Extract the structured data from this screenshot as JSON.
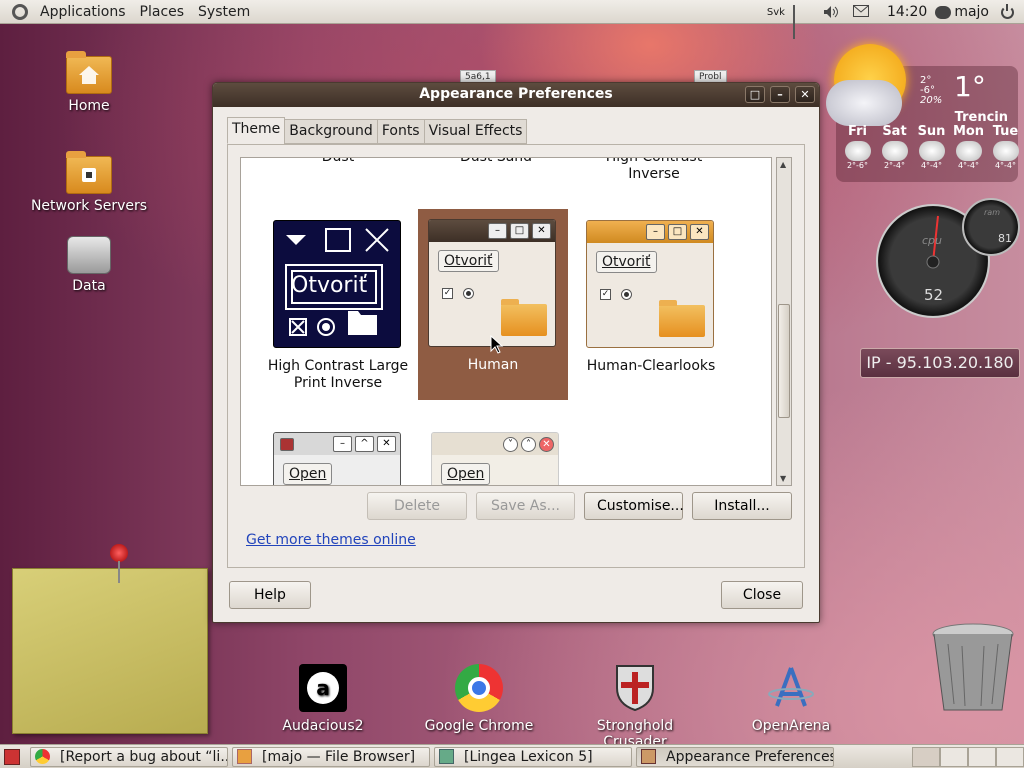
{
  "top_panel": {
    "menus": [
      "Applications",
      "Places",
      "System"
    ],
    "keyboard_layout": "Svk",
    "clock": "14:20",
    "username": "majo"
  },
  "desktop_icons": [
    {
      "label": "Home",
      "icon": "home-folder-icon"
    },
    {
      "label": "Network Servers",
      "icon": "network-folder-icon"
    },
    {
      "label": "Data",
      "icon": "drive-icon"
    }
  ],
  "background_files": [
    "5a6,1",
    "Probl"
  ],
  "window": {
    "title": "Appearance Preferences",
    "tabs": [
      {
        "label": "Theme",
        "active": true
      },
      {
        "label": "Background",
        "active": false
      },
      {
        "label": "Fonts",
        "active": false
      },
      {
        "label": "Visual Effects",
        "active": false
      }
    ],
    "themes": [
      {
        "name": "Dust",
        "partial": true
      },
      {
        "name": "Dust Sand",
        "partial": true
      },
      {
        "name": "High Contrast Inverse",
        "partial": true
      },
      {
        "name": "High Contrast Large Print Inverse",
        "selected": false
      },
      {
        "name": "Human",
        "selected": true
      },
      {
        "name": "Human-Clearlooks",
        "selected": false
      }
    ],
    "thumbnail_button_label": "Otvoriť",
    "thumbnail_open_label": "Open",
    "buttons": {
      "delete": "Delete",
      "save_as": "Save As...",
      "customise": "Customise...",
      "install": "Install..."
    },
    "link": "Get more themes online",
    "help": "Help",
    "close": "Close"
  },
  "weather": {
    "temp": "1°",
    "hi": "2°",
    "lo": "-6°",
    "humidity": "20%",
    "city": "Trencin",
    "days": [
      {
        "day": "Fri",
        "range": "2°-6°"
      },
      {
        "day": "Sat",
        "range": "2°-4°"
      },
      {
        "day": "Sun",
        "range": "4°-4°"
      },
      {
        "day": "Mon",
        "range": "4°-4°"
      },
      {
        "day": "Tue",
        "range": "4°-4°"
      }
    ]
  },
  "gauges": {
    "cpu_label": "cpu",
    "cpu_value": "52",
    "ram_label": "ram",
    "ram_value": "81"
  },
  "ip_widget": "IP - 95.103.20.180",
  "dock": [
    "Audacious2",
    "Google Chrome",
    "Stronghold Crusader",
    "OpenArena"
  ],
  "taskbar": {
    "tasks": [
      {
        "label": "[Report a bug about “li...",
        "active": false
      },
      {
        "label": "[majo — File Browser]",
        "active": false
      },
      {
        "label": "[Lingea Lexicon 5]",
        "active": false
      },
      {
        "label": "Appearance Preferences",
        "active": true
      }
    ]
  }
}
